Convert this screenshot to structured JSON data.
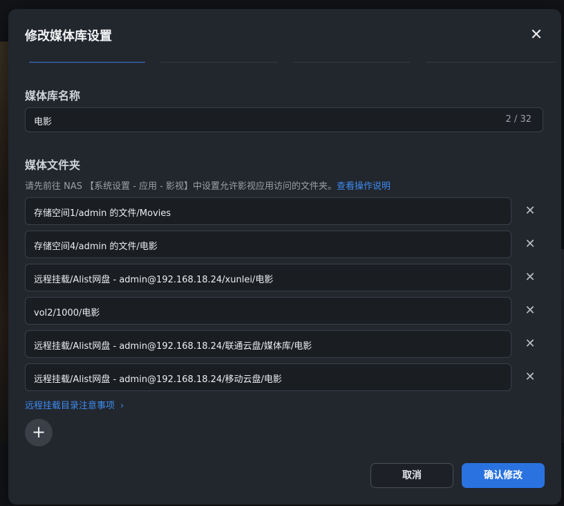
{
  "dialog": {
    "title": "修改媒体库设置",
    "close_icon": "✕"
  },
  "library_name": {
    "label": "媒体库名称",
    "value": "电影",
    "counter": "2 / 32"
  },
  "media_folders": {
    "label": "媒体文件夹",
    "hint_text": "请先前往 NAS 【系统设置 - 应用 - 影视】中设置允许影视应用访问的文件夹。",
    "hint_link": "查看操作说明",
    "items": [
      {
        "path": "存储空间1/admin 的文件/Movies"
      },
      {
        "path": "存储空间4/admin 的文件/电影"
      },
      {
        "path": "远程挂载/Alist网盘 - admin@192.168.18.24/xunlei/电影"
      },
      {
        "path": "vol2/1000/电影"
      },
      {
        "path": "远程挂载/Alist网盘 - admin@192.168.18.24/联通云盘/媒体库/电影"
      },
      {
        "path": "远程挂载/Alist网盘 - admin@192.168.18.24/移动云盘/电影"
      }
    ],
    "remove_icon": "✕",
    "remote_notice_link": "远程挂载目录注意事项",
    "chevron_icon": "›",
    "add_icon": "+"
  },
  "footer": {
    "cancel_label": "取消",
    "confirm_label": "确认修改"
  },
  "colors": {
    "accent": "#2a72e0",
    "link": "#3d8cf0",
    "panel": "#22262d"
  }
}
